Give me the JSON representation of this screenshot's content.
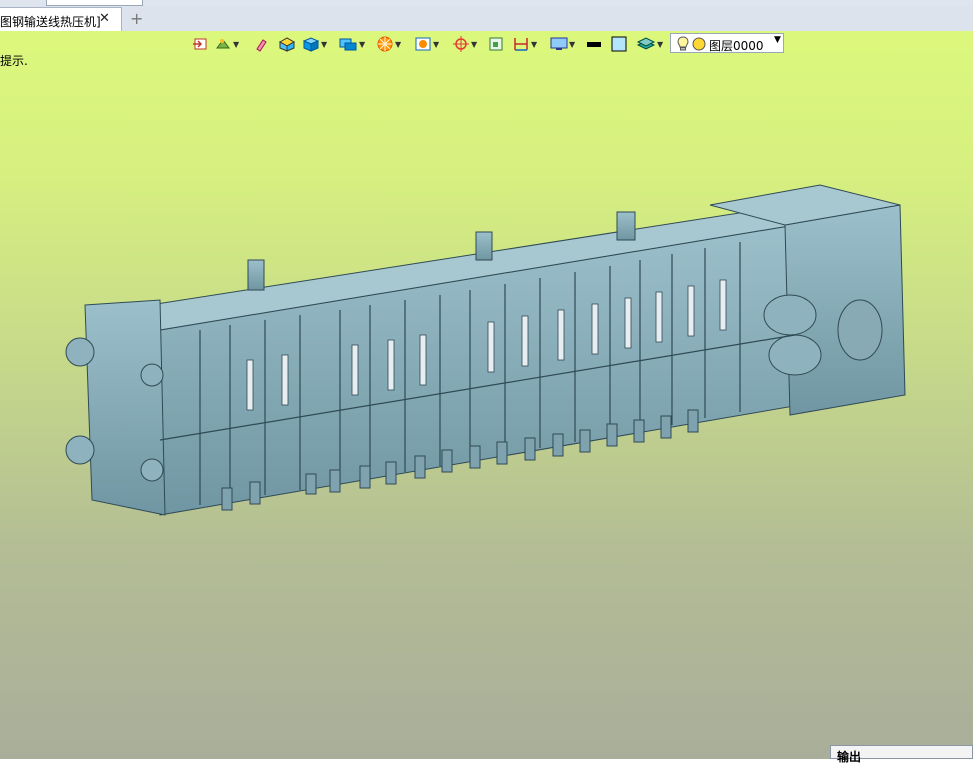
{
  "document_tab": {
    "title": "图钢输送线热压机]",
    "close_glyph": "✕",
    "add_glyph": "+"
  },
  "toolbar": {
    "buttons": [
      {
        "name": "exit-sketch-icon"
      },
      {
        "name": "style-icon",
        "dropdown": true
      },
      {
        "name": "eraser-icon"
      },
      {
        "name": "shaded-box-icon"
      },
      {
        "name": "solid-box-icon",
        "dropdown": true
      },
      {
        "name": "display-mode-icon",
        "dropdown": true
      },
      {
        "name": "filter-icon",
        "dropdown": true
      },
      {
        "name": "view-icon",
        "dropdown": true
      },
      {
        "name": "coordinate-icon",
        "dropdown": true
      },
      {
        "name": "grid-icon"
      },
      {
        "name": "dimension-icon",
        "dropdown": true
      },
      {
        "name": "monitor-icon",
        "dropdown": true
      },
      {
        "name": "line-color-icon"
      },
      {
        "name": "fill-color-icon"
      },
      {
        "name": "layers-icon",
        "dropdown": true
      }
    ],
    "layer_select": {
      "value": "图层0000",
      "caret": "▼"
    }
  },
  "hint_text": "提示.",
  "output_panel": {
    "title": "输出"
  },
  "colors": {
    "viewport_top": "#dcf87c",
    "viewport_bottom": "#a9ae9a",
    "model_fill": "#8fb3be",
    "model_edge": "#2f4a55"
  }
}
